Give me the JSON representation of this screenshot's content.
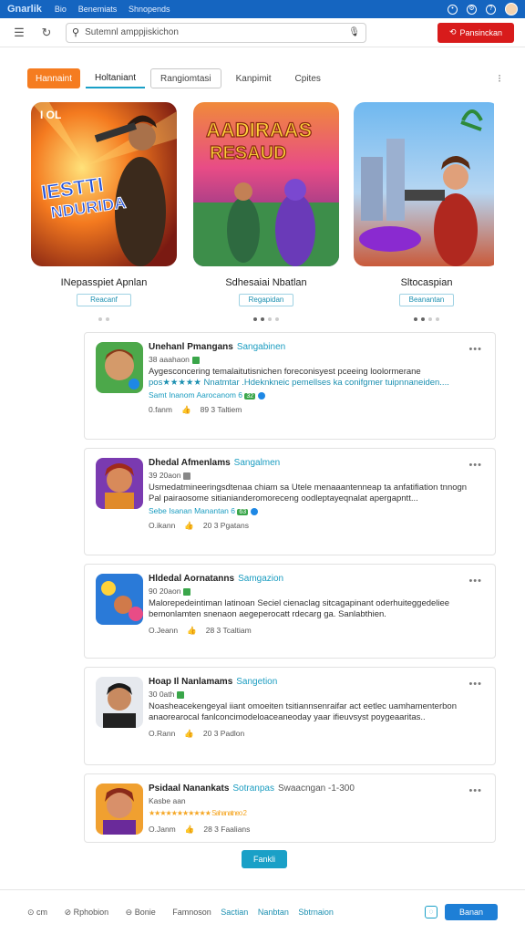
{
  "topbar": {
    "logo": "Gnarlik",
    "nav": [
      "Bio",
      "Benemiats",
      "Shnopends"
    ],
    "icons": [
      "notification-icon",
      "settings-icon",
      "help-icon"
    ]
  },
  "search": {
    "placeholder": "Sutemnl amppjiskichon",
    "cta_label": "Pansinckan"
  },
  "tabs": {
    "items": [
      "Hannaint",
      "Holtaniant",
      "Rangiomtasi",
      "Kanpimit",
      "Cpites"
    ],
    "more": "⁝"
  },
  "featured": [
    {
      "title": "INepasspiet Apnlan",
      "button": "Reacanf",
      "art_text": "IESTTI NDURIDA"
    },
    {
      "title": "Sdhesaiai Nbatlan",
      "button": "Regapidan",
      "art_text": "AADIRAAS RESAUD"
    },
    {
      "title": "Sltocaspian",
      "button": "Beanantan",
      "art_text": ""
    }
  ],
  "list": [
    {
      "title": "Unehanl Pmangans",
      "tag": "Sangabinen",
      "extra": "",
      "sub": "38 aaahaon",
      "desc": "Aygesconcering temalaitutisnichen foreconisyest pceeing loolormerane",
      "desc2": "pos★★★★★ Nnatmtar .Hdeknkneic pemellses ka conifgmer tuipnnaneiden....",
      "meta": "Samt Inanom Aarocanom 6",
      "badge": "32",
      "stats": [
        "0.fanm",
        "89 3 Taltiem"
      ]
    },
    {
      "title": "Dhedal Afmenlams",
      "tag": "Sangalmen",
      "extra": "",
      "sub": "39 20aon",
      "desc": "Usmedatmineeringsdtenaa chiam sa Utele menaaantenneap ta anfatifiation tnnogn",
      "desc2": "Pal pairaosome sitianianderomoreceng oodleptayeqnalat apergapntt...",
      "meta": "Sebe Isanan Manantan 6",
      "badge": "63",
      "stats": [
        "O.ikann",
        "20 3 Pgatans"
      ]
    },
    {
      "title": "Hldedal Aornatanns",
      "tag": "Samgazion",
      "extra": "",
      "sub": "90 20aon",
      "desc": "Malorepedeintiman latinoan Seciel cienaclag sitcagapinant oderhuiteggedeliee",
      "desc2": "bemonlamten  snenaon aegeperocatt rdecarg ga. Sanlabthien.",
      "meta": "",
      "badge": "",
      "stats": [
        "O.Jeann",
        "28 3 Tcaltiam"
      ]
    },
    {
      "title": "Hoap Il Nanlamams",
      "tag": "Sangetion",
      "extra": "",
      "sub": "30 0ath",
      "desc": "Noasheacekengeyal iiant omoeiten tsitiannsenraifar act eetlec uamhamenterbon",
      "desc2": "anaorearocal fanlconcimodeloaceaneoday yaar ifieuvsyst poygeaaritas..",
      "meta": "",
      "badge": "",
      "stats": [
        "O.Rann",
        "20 3 Padlon"
      ]
    },
    {
      "title": "Psidaal Nanankats",
      "tag": "Sotranpas",
      "extra": "Swaacngan -1-300",
      "sub": "Kasbe aan",
      "desc": "",
      "desc2": "★★★★★★★★★★★ Sahanatneo 2",
      "meta": "",
      "badge": "",
      "stats": [
        "O.Janm",
        "28 3 Faalians"
      ]
    }
  ],
  "load_more": "Fankli",
  "footer": {
    "items": [
      "cm",
      "Rphobion",
      "Bonie"
    ],
    "links": [
      "Famnoson",
      "Sactian",
      "Nanbtan",
      "Sbtrnaion"
    ],
    "button": "Banan"
  },
  "colors": {
    "brand_blue": "#1565c0",
    "accent_orange": "#f57c20",
    "cta_red": "#d81b1b",
    "teal": "#1aa0c7"
  }
}
